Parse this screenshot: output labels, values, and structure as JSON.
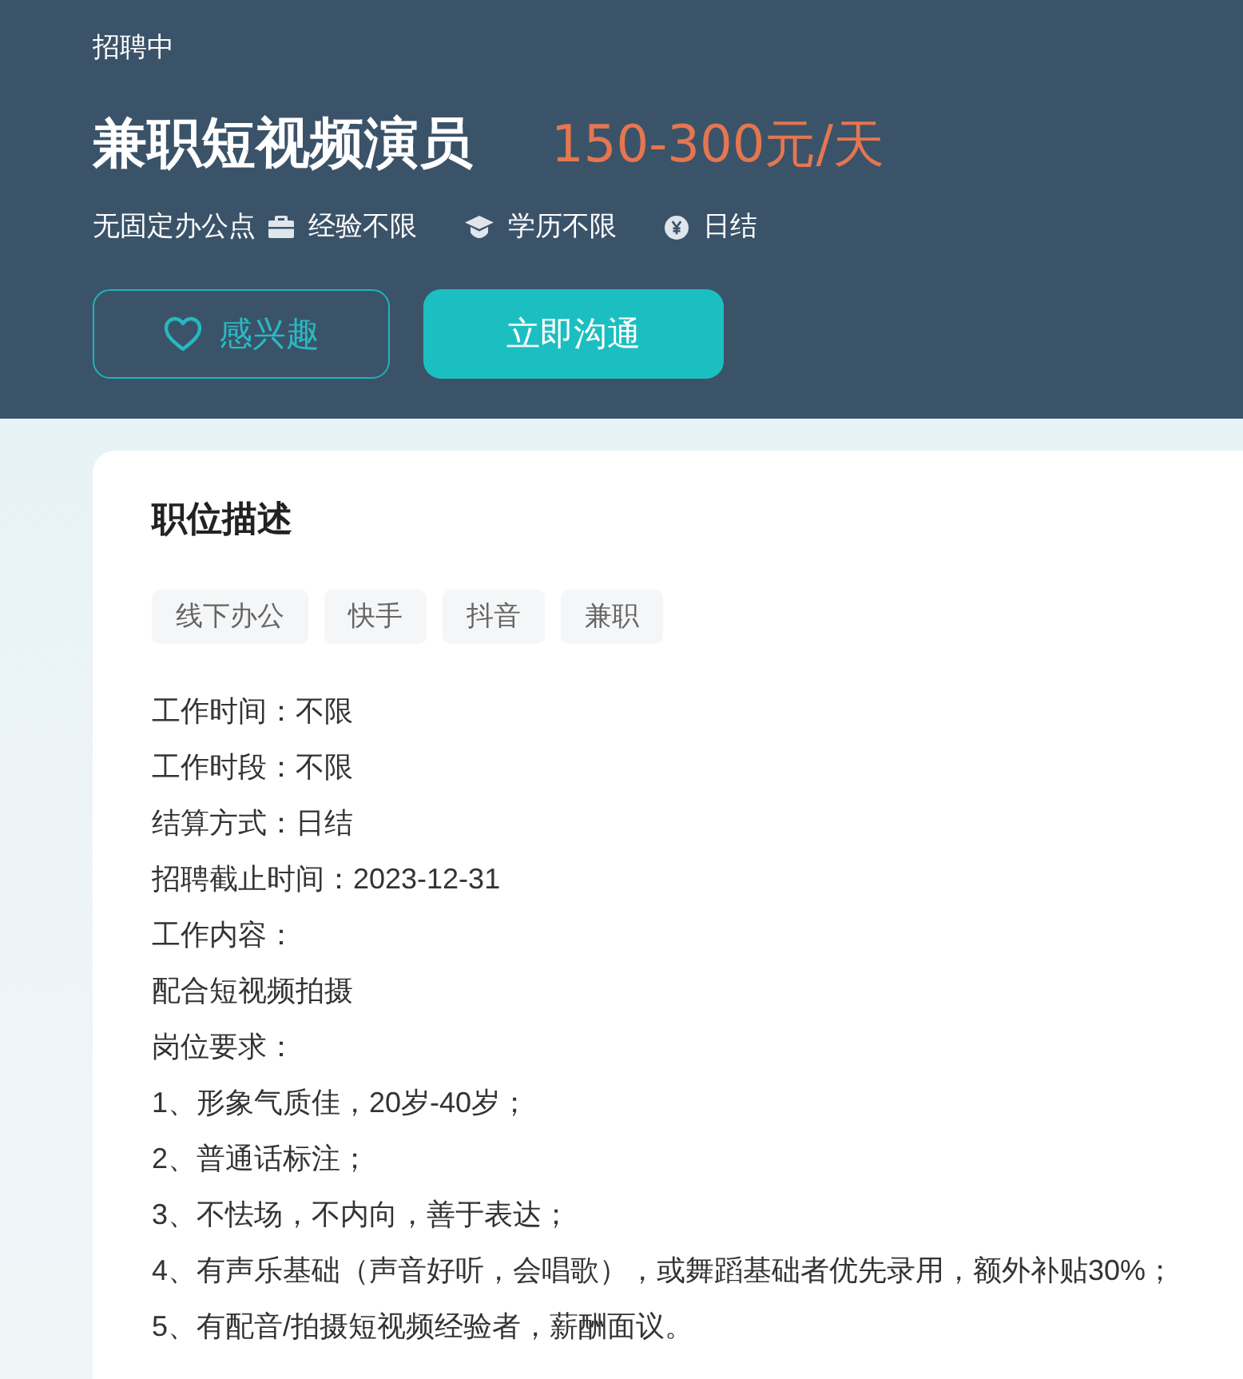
{
  "header": {
    "status": "招聘中",
    "title": "兼职短视频演员",
    "salary": "150-300元/天",
    "meta": [
      {
        "kind": "location",
        "text": "无固定办公点"
      },
      {
        "kind": "experience",
        "text": "经验不限"
      },
      {
        "kind": "education",
        "text": "学历不限"
      },
      {
        "kind": "payment",
        "text": "日结"
      }
    ],
    "buttons": [
      {
        "kind": "favorite",
        "label": "感兴趣"
      },
      {
        "kind": "primary",
        "label": "立即沟通"
      }
    ]
  },
  "description": {
    "title": "职位描述",
    "tags": [
      "线下办公",
      "快手",
      "抖音",
      "兼职"
    ],
    "lines": [
      "工作时间：不限",
      "工作时段：不限",
      "结算方式：日结",
      "招聘截止时间：2023-12-31",
      "工作内容：",
      "配合短视频拍摄",
      "岗位要求：",
      "1、形象气质佳，20岁-40岁；",
      "2、普通话标注；",
      "3、不怯场，不内向，善于表达；",
      "4、有声乐基础（声音好听，会唱歌），或舞蹈基础者优先录用，额外补贴30%；",
      "5、有配音/拍摄短视频经验者，薪酬面议。"
    ]
  }
}
